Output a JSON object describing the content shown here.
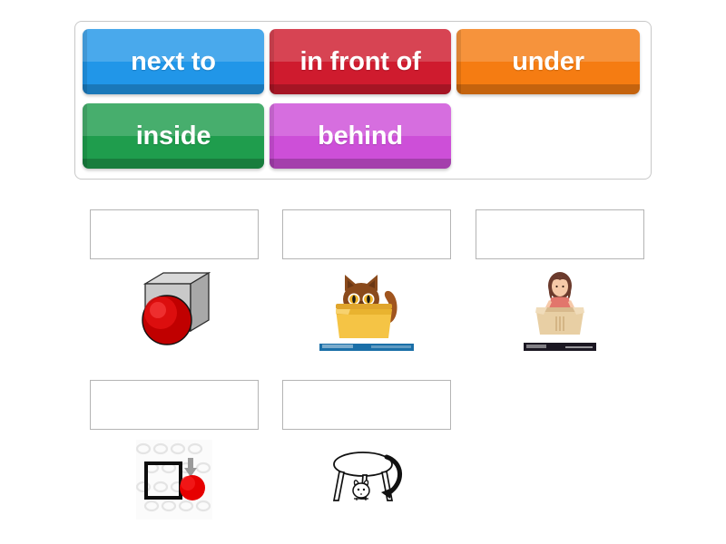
{
  "activity": {
    "type": "drag-and-drop-labelling",
    "background_color": "#ffffff"
  },
  "word_bank": {
    "container_border_color": "#c8c8c8",
    "tiles": [
      {
        "label": "next to",
        "color": "#2196e8",
        "color_dark": "#1277bd",
        "color_light": "#55b7f2",
        "text_color": "#ffffff"
      },
      {
        "label": "in front of",
        "color": "#cf1b2e",
        "color_dark": "#a8121f",
        "color_light": "#e03a4c",
        "text_color": "#ffffff"
      },
      {
        "label": "under",
        "color": "#f57c12",
        "color_dark": "#d2620a",
        "color_light": "#fb963c",
        "text_color": "#ffffff"
      },
      {
        "label": "inside",
        "color": "#1f9d4d",
        "color_dark": "#157a38",
        "color_light": "#3cbb68",
        "text_color": "#ffffff"
      },
      {
        "label": "behind",
        "color": "#cd4fd8",
        "color_dark": "#b32fc0",
        "color_light": "#dd7ce6",
        "text_color": "#ffffff"
      }
    ]
  },
  "answer_rows": [
    {
      "cells": [
        {
          "drop_zone_value": "",
          "image_name": "ball-in-front-of-grey-box",
          "image_alt": "Red ball in front of a grey 3D box"
        },
        {
          "drop_zone_value": "",
          "image_name": "cat-inside-yellow-box",
          "image_alt": "Brown cat sitting inside a yellow box"
        },
        {
          "drop_zone_value": "",
          "image_name": "woman-inside-cardboard-box",
          "image_alt": "Woman standing inside a cardboard box"
        }
      ]
    },
    {
      "cells": [
        {
          "drop_zone_value": "",
          "image_name": "ball-next-to-square",
          "image_alt": "Red ball next to a black square with a grey arrow"
        },
        {
          "drop_zone_value": "",
          "image_name": "mouse-under-table",
          "image_alt": "Line drawing of a mouse under a table with a curved arrow"
        }
      ]
    }
  ],
  "drop_zone": {
    "border_color": "#b4b4b4",
    "placeholder": ""
  }
}
